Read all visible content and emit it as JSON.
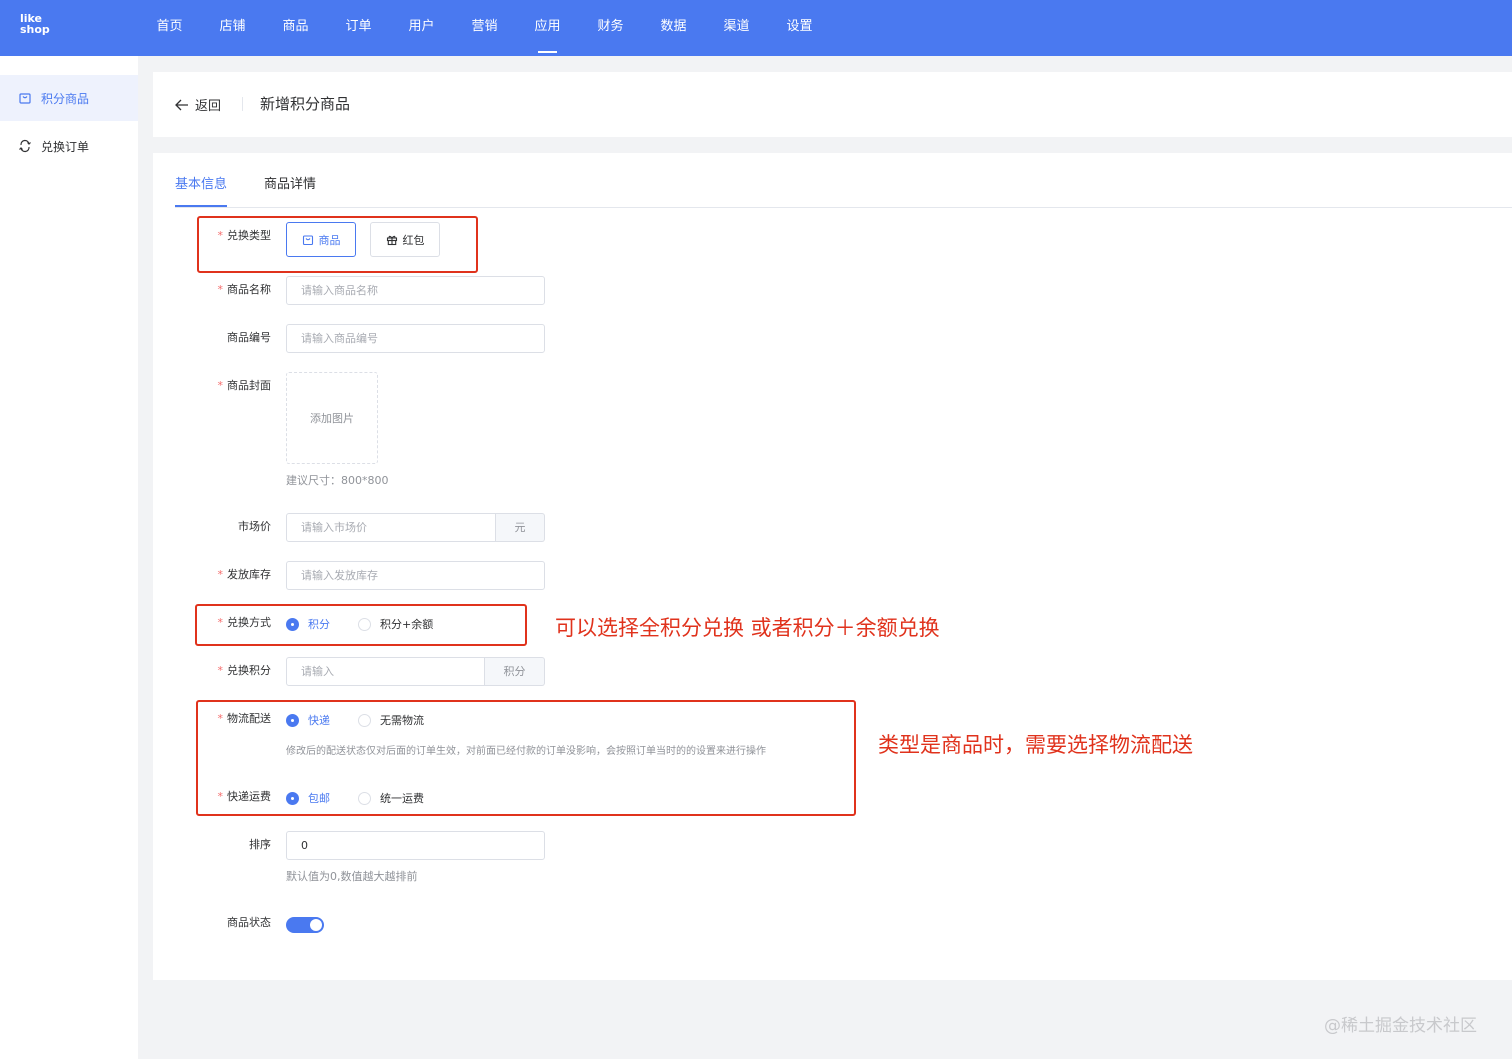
{
  "logo": {
    "line1": "like",
    "line2": "shop"
  },
  "nav": {
    "items": [
      "首页",
      "店铺",
      "商品",
      "订单",
      "用户",
      "营销",
      "应用",
      "财务",
      "数据",
      "渠道",
      "设置"
    ],
    "active_index": 6
  },
  "sidebar": {
    "items": [
      {
        "label": "积分商品",
        "icon": "shopping-bag-icon"
      },
      {
        "label": "兑换订单",
        "icon": "exchange-icon"
      }
    ],
    "active_index": 0
  },
  "header": {
    "back_label": "返回",
    "title": "新增积分商品"
  },
  "tabs": [
    "基本信息",
    "商品详情"
  ],
  "form": {
    "exchange_type": {
      "label": "兑换类型",
      "required": true,
      "options": [
        "商品",
        "红包"
      ],
      "selected": "商品"
    },
    "product_name": {
      "label": "商品名称",
      "required": true,
      "placeholder": "请输入商品名称"
    },
    "product_code": {
      "label": "商品编号",
      "required": false,
      "placeholder": "请输入商品编号"
    },
    "cover": {
      "label": "商品封面",
      "required": true,
      "upload_text": "添加图片",
      "hint": "建议尺寸：800*800"
    },
    "market_price": {
      "label": "市场价",
      "required": false,
      "placeholder": "请输入市场价",
      "unit": "元"
    },
    "stock": {
      "label": "发放库存",
      "required": true,
      "placeholder": "请输入发放库存"
    },
    "exchange_method": {
      "label": "兑换方式",
      "required": true,
      "options": [
        "积分",
        "积分+余额"
      ],
      "selected": "积分"
    },
    "exchange_points": {
      "label": "兑换积分",
      "required": true,
      "placeholder": "请输入",
      "unit": "积分"
    },
    "logistics": {
      "label": "物流配送",
      "required": true,
      "options": [
        "快递",
        "无需物流"
      ],
      "selected": "快递",
      "hint": "修改后的配送状态仅对后面的订单生效，对前面已经付款的订单没影响，会按照订单当时的的设置来进行操作"
    },
    "shipping_fee": {
      "label": "快递运费",
      "required": true,
      "options": [
        "包邮",
        "统一运费"
      ],
      "selected": "包邮"
    },
    "sort": {
      "label": "排序",
      "required": false,
      "value": "0",
      "hint": "默认值为0,数值越大越排前"
    },
    "status": {
      "label": "商品状态",
      "enabled": true
    }
  },
  "annotations": {
    "exchange_method_note": "可以选择全积分兑换 或者积分＋余额兑换",
    "logistics_note": "类型是商品时，需要选择物流配送"
  },
  "watermark": "@稀土掘金技术社区",
  "colors": {
    "primary": "#4a79f0",
    "annotation": "#e0321c",
    "required": "#f56c6c"
  }
}
